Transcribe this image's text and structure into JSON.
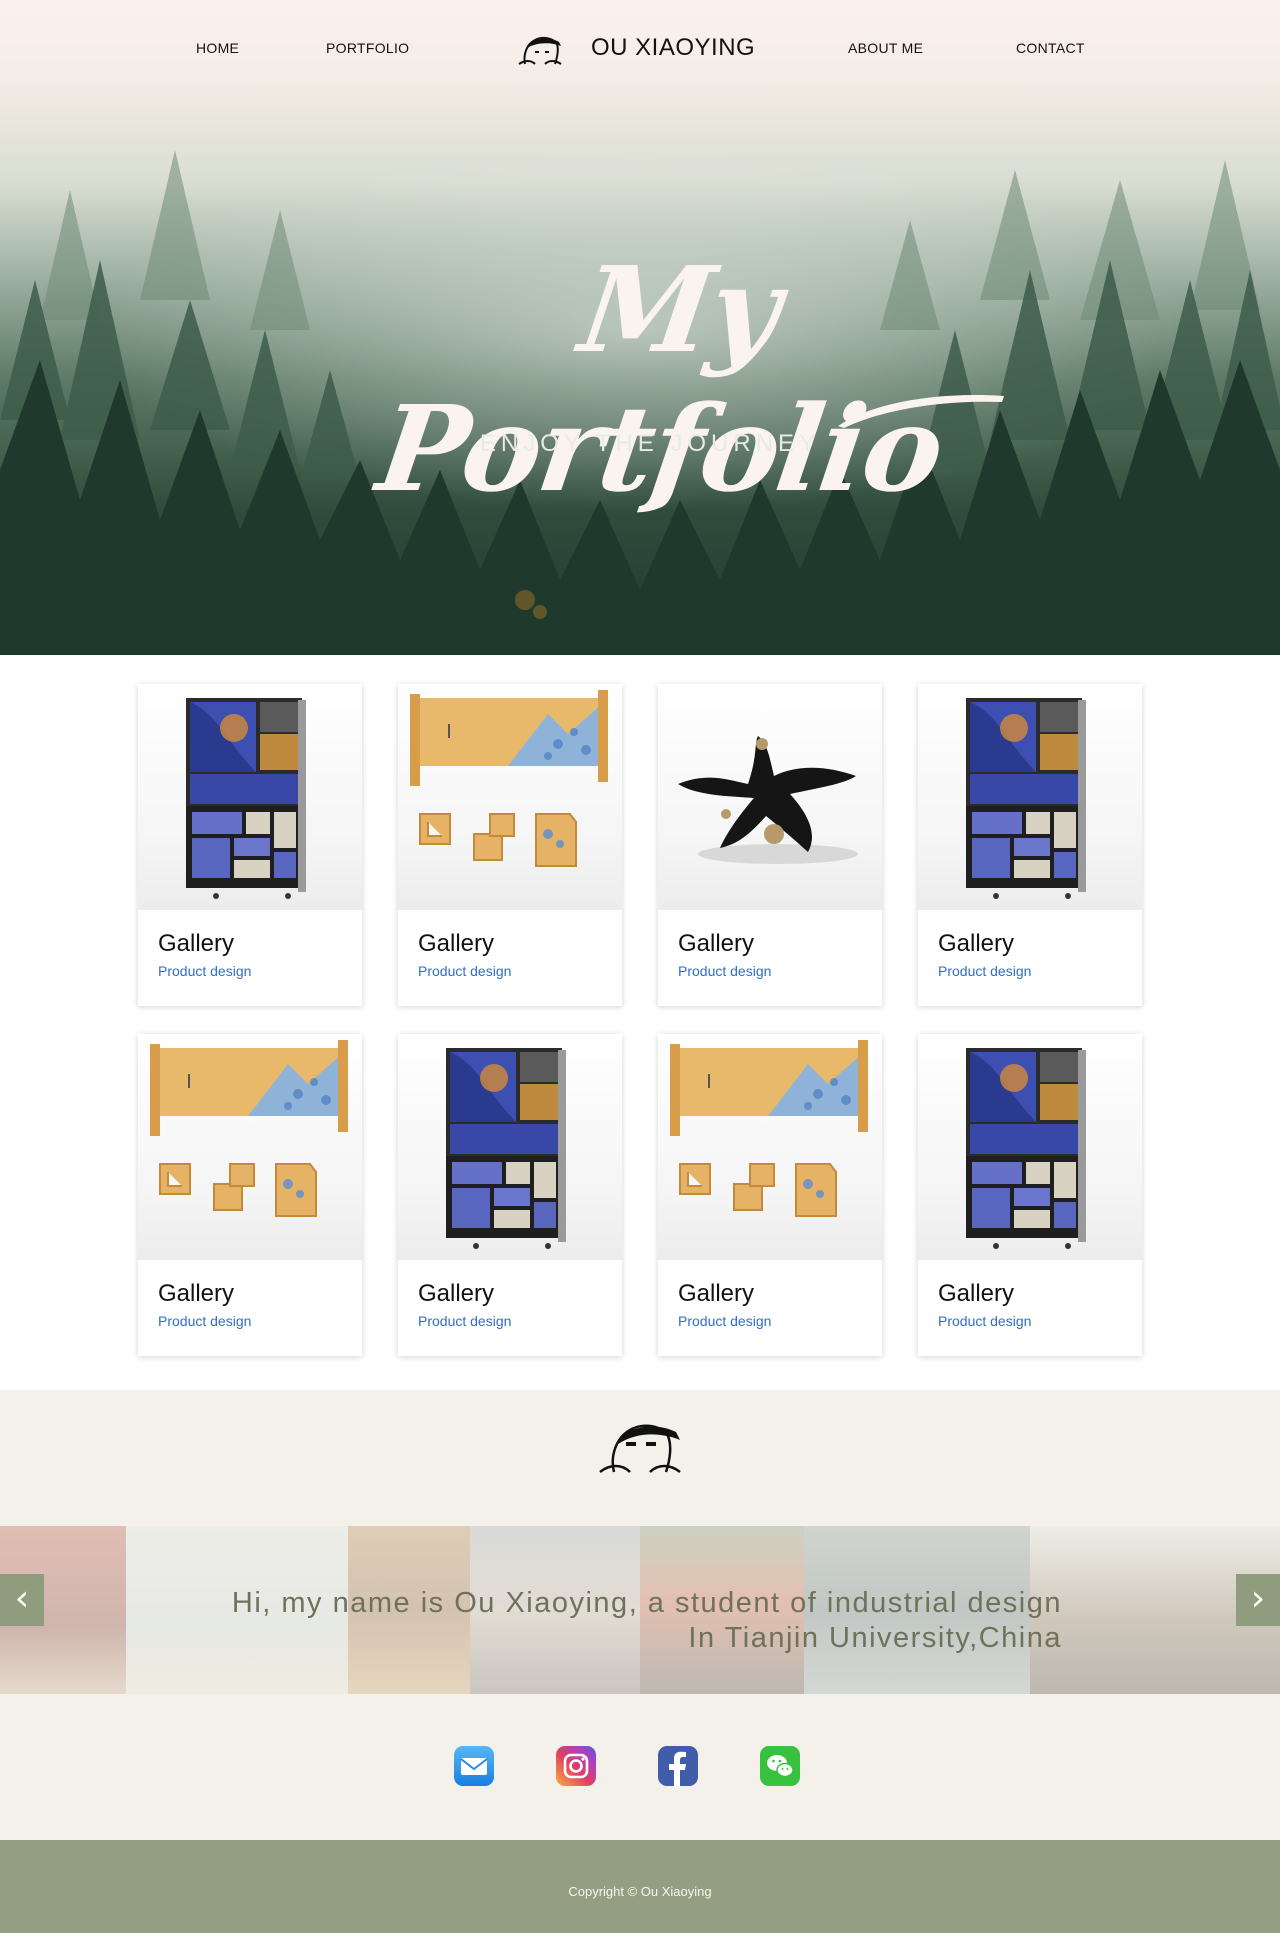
{
  "nav": {
    "home": "HOME",
    "portfolio": "PORTFOLIO",
    "brand": "OU XIAOYING",
    "about": "ABOUT ME",
    "contact": "CONTACT"
  },
  "hero": {
    "title": "My Portfolio",
    "subtitle": "ENJOY THE  JOURNEY"
  },
  "gallery": {
    "cards": [
      {
        "title": "Gallery",
        "subtitle": "Product design",
        "image": "cabinet"
      },
      {
        "title": "Gallery",
        "subtitle": "Product design",
        "image": "shelf"
      },
      {
        "title": "Gallery",
        "subtitle": "Product design",
        "image": "sculpture"
      },
      {
        "title": "Gallery",
        "subtitle": "Product design",
        "image": "cabinet"
      },
      {
        "title": "Gallery",
        "subtitle": "Product design",
        "image": "shelf"
      },
      {
        "title": "Gallery",
        "subtitle": "Product design",
        "image": "cabinet"
      },
      {
        "title": "Gallery",
        "subtitle": "Product design",
        "image": "shelf"
      },
      {
        "title": "Gallery",
        "subtitle": "Product design",
        "image": "cabinet"
      }
    ]
  },
  "about": {
    "line1": "Hi,  my name is Ou Xiaoying,  a student of industrial  design",
    "line2": "In Tianjin University,China",
    "prev_icon": "chevron-left-icon",
    "next_icon": "chevron-right-icon"
  },
  "socials": [
    {
      "name": "mail-icon"
    },
    {
      "name": "instagram-icon"
    },
    {
      "name": "facebook-icon"
    },
    {
      "name": "wechat-icon"
    }
  ],
  "footer": {
    "copyright": "Copyright © Ou Xiaoying"
  },
  "colors": {
    "link_blue": "#2f6fc4",
    "band_bg": "#f4f1ea",
    "footer_bg": "#949e82",
    "arrow_bg": "#8f9c7e"
  }
}
